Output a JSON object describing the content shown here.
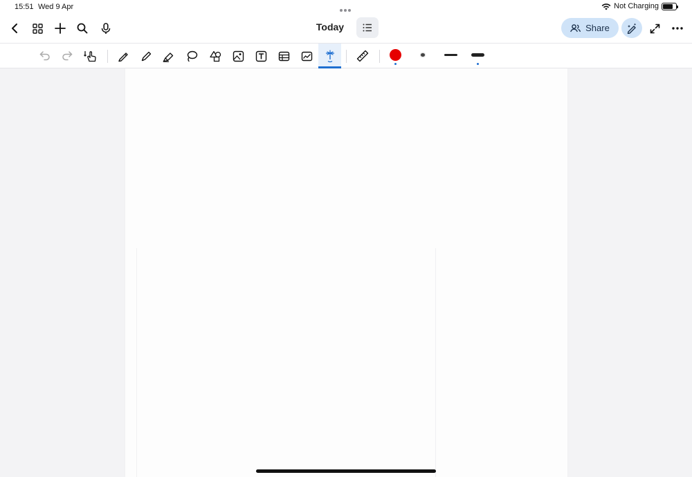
{
  "status_bar": {
    "time": "15:51",
    "date": "Wed 9 Apr",
    "charging": "Not Charging",
    "battery_level": 0.75
  },
  "nav": {
    "title": "Today",
    "share_label": "Share",
    "icons": [
      "chevron-left-icon",
      "grid-icon",
      "plus-icon",
      "search-icon",
      "microphone-icon",
      "list-icon",
      "people-icon",
      "pencil-sparkle-icon",
      "expand-icon",
      "more-icon"
    ]
  },
  "toolbar": {
    "tools": [
      "undo-icon",
      "redo-icon",
      "touch-draw-icon",
      "pen-icon",
      "pencil-icon",
      "highlighter-icon",
      "lasso-icon",
      "shapes-icon",
      "image-icon",
      "text-box-icon",
      "table-icon",
      "chart-icon",
      "laser-pointer-icon",
      "ruler-icon"
    ],
    "active_tool": "laser-pointer-icon",
    "pen_color": "#e60000",
    "stroke_widths": [
      "thin",
      "medium",
      "thick"
    ],
    "selected_stroke": "thick"
  },
  "colors": {
    "accent": "#1f6fd1",
    "share_bg": "#cfe3f8",
    "canvas_bg": "#f3f3f5",
    "page_bg": "#fdfdfd"
  }
}
